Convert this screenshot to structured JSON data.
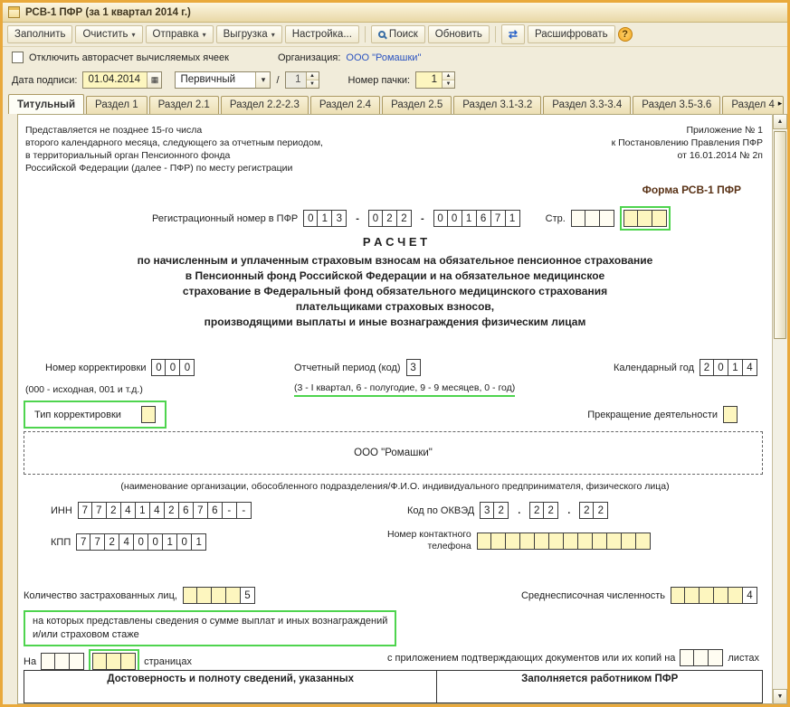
{
  "window": {
    "title": "РСВ-1 ПФР (за 1 квартал 2014 г.)"
  },
  "colors": {
    "highlight": "#4ed44e",
    "link": "#2b53c0",
    "cell_fill": "#fdf6bf"
  },
  "icons": {
    "dropdown": "▾",
    "calendar": "▦",
    "spin_up": "▲",
    "spin_down": "▼",
    "scroll_up": "▲",
    "scroll_down": "▼",
    "tab_scroll": "▸",
    "exchange": "⇄",
    "help": "?"
  },
  "toolbar": {
    "fill": "Заполнить",
    "clear": "Очистить",
    "send": "Отправка",
    "unload": "Выгрузка",
    "settings": "Настройка...",
    "search": "Поиск",
    "refresh": "Обновить",
    "decrypt": "Расшифровать"
  },
  "options": {
    "autocalc_checkbox": "Отключить авторасчет вычисляемых ячеек",
    "org_label": "Организация:",
    "org_value": "ООО \"Ромашки\""
  },
  "header_fields": {
    "sign_date_label": "Дата подписи:",
    "sign_date_value": "01.04.2014",
    "type_value": "Первичный",
    "slash": "/",
    "rev_value": "1",
    "pack_label": "Номер пачки:",
    "pack_value": "1"
  },
  "tabs": [
    "Титульный",
    "Раздел 1",
    "Раздел 2.1",
    "Раздел 2.2-2.3",
    "Раздел 2.4",
    "Раздел 2.5",
    "Раздел 3.1-3.2",
    "Раздел 3.3-3.4",
    "Раздел 3.5-3.6",
    "Раздел 4"
  ],
  "form": {
    "submit_note_lines": [
      "Представляется не позднее 15-го числа",
      "второго календарного месяца, следующего за отчетным периодом,",
      "в территориальный орган Пенсионного фонда",
      "Российской Федерации (далее - ПФР) по месту регистрации"
    ],
    "appendix_lines": [
      "Приложение № 1",
      "к Постановлению Правления ПФР",
      "от 16.01.2014 № 2п"
    ],
    "form_name": "Форма РСВ-1 ПФР",
    "reg_label": "Регистрационный номер в ПФР",
    "reg_g1": [
      "0",
      "1",
      "3"
    ],
    "reg_g2": [
      "0",
      "2",
      "2"
    ],
    "reg_g3": [
      "0",
      "0",
      "1",
      "6",
      "7",
      "1"
    ],
    "dash": "-",
    "dot": ".",
    "page_label": "Стр.",
    "page_g1": [
      "",
      "",
      ""
    ],
    "page_g2": [
      "",
      "",
      ""
    ],
    "calc_title": "Р А С Ч Е Т",
    "calc_lines": [
      "по начисленным и уплаченным страховым взносам на обязательное пенсионное страхование",
      "в Пенсионный фонд Российской Федерации и на обязательное медицинское",
      "страхование в Федеральный фонд обязательного медицинского страхования",
      "плательщиками страховых взносов,",
      "производящими выплаты и иные вознаграждения физическим лицам"
    ],
    "correction_label": "Номер корректировки",
    "correction_cells": [
      "0",
      "0",
      "0"
    ],
    "correction_note": "(000 - исходная, 001 и т.д.)",
    "period_label": "Отчетный период (код)",
    "period_cells": [
      "3"
    ],
    "period_note": "(3 - I квартал, 6 - полугодие, 9 - 9 месяцев, 0 - год)",
    "year_label": "Календарный год",
    "year_cells": [
      "2",
      "0",
      "1",
      "4"
    ],
    "corr_type_label": "Тип корректировки",
    "corr_type_cells": [
      ""
    ],
    "termination_label": "Прекращение деятельности",
    "termination_cells": [
      ""
    ],
    "org_name": "ООО \"Ромашки\"",
    "org_caption": "(наименование организации, обособленного подразделения/Ф.И.О. индивидуального предпринимателя, физического лица)",
    "inn_label": "ИНН",
    "inn_cells": [
      "7",
      "7",
      "2",
      "4",
      "1",
      "4",
      "2",
      "6",
      "7",
      "6",
      "-",
      "-"
    ],
    "okved_label": "Код по ОКВЭД",
    "okved_g1": [
      "3",
      "2"
    ],
    "okved_g2": [
      "2",
      "2"
    ],
    "okved_g3": [
      "2",
      "2"
    ],
    "kpp_label": "КПП",
    "kpp_cells": [
      "7",
      "7",
      "2",
      "4",
      "0",
      "0",
      "1",
      "0",
      "1"
    ],
    "phone_label_1": "Номер контактного",
    "phone_label_2": "телефона",
    "phone_cells": [
      "",
      "",
      "",
      "",
      "",
      "",
      "",
      "",
      "",
      "",
      "",
      ""
    ],
    "insured_label": "Количество застрахованных лиц,",
    "insured_cells": [
      "",
      "",
      "",
      "",
      "5"
    ],
    "avg_label": "Среднесписочная численность",
    "avg_cells": [
      "",
      "",
      "",
      "",
      "",
      "4"
    ],
    "insured_note_1": "на которых представлены сведения о сумме выплат и иных вознаграждений",
    "insured_note_2": "и/или страховом стаже",
    "pages_prefix": "На",
    "pages_g1": [
      "",
      "",
      ""
    ],
    "pages_g2": [
      "",
      "",
      ""
    ],
    "pages_suffix": "страницах",
    "attach_label": "с приложением подтверждающих документов или их копий на",
    "attach_cells": [
      "",
      "",
      ""
    ],
    "attach_suffix": "листах",
    "footer_left": "Достоверность и полноту сведений, указанных",
    "footer_right": "Заполняется работником ПФР"
  }
}
